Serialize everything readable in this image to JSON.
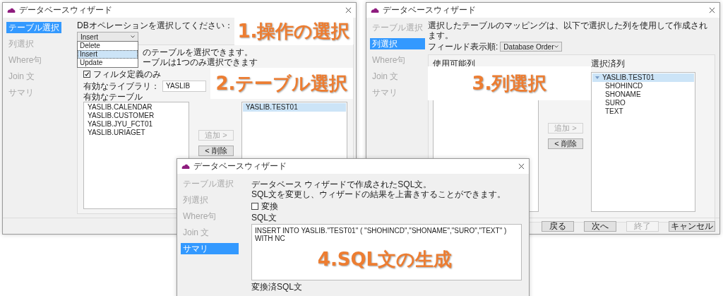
{
  "window_1": {
    "title": "データベースウィザード",
    "steps": [
      {
        "label": "テーブル選択",
        "selected": true
      },
      {
        "label": "列選択",
        "selected": false
      },
      {
        "label": "Where句",
        "selected": false
      },
      {
        "label": "Join 文",
        "selected": false
      },
      {
        "label": "サマリ",
        "selected": false
      }
    ],
    "operation_label": "DBオペレーションを選択してください：",
    "operation_value": "Insert",
    "operation_options": [
      {
        "label": "Delete",
        "selected": false
      },
      {
        "label": "Insert",
        "selected": true
      },
      {
        "label": "Update",
        "selected": false
      }
    ],
    "instructions": [
      "のテーブルを選択できます。",
      "ーブルは1つのみ選択できます"
    ],
    "filter_checkbox": {
      "label": "フィルタ定義のみ",
      "checked": true
    },
    "library_label": "有効なライブラリ：",
    "library_value": "YASLIB",
    "tables_label": "有効なテーブル",
    "available_tables": [
      "YASLIB.CALENDAR",
      "YASLIB.CUSTOMER",
      "YASLIB.JYU_FCT01",
      "YASLIB.URIAGET"
    ],
    "add_button": {
      "label": "追加 >",
      "disabled": true
    },
    "remove_button": {
      "label": "< 削除",
      "disabled": false
    },
    "selected_tables": [
      {
        "label": "YASLIB.TEST01",
        "selected": true
      }
    ]
  },
  "window_2": {
    "title": "データベースウィザード",
    "steps": [
      {
        "label": "テーブル選択",
        "selected": false
      },
      {
        "label": "列選択",
        "selected": true
      },
      {
        "label": "Where句",
        "selected": false
      },
      {
        "label": "Join 文",
        "selected": false
      },
      {
        "label": "サマリ",
        "selected": false
      }
    ],
    "description": "選択したテーブルのマッピングは、以下で選択した列を使用して作成されます。",
    "order_label": "フィールド表示順:",
    "order_value": "Database Order",
    "available_columns_label": "使用可能列",
    "selected_columns_label": "選択済列",
    "selected_tree": [
      {
        "label": "YASLIB.TEST01",
        "expanded": true,
        "selected": true,
        "children": [
          {
            "label": "SHOHINCD",
            "selected": false
          },
          {
            "label": "SHONAME",
            "selected": false
          },
          {
            "label": "SURO",
            "selected": false
          },
          {
            "label": "TEXT",
            "selected": false
          }
        ]
      }
    ],
    "add_button": {
      "label": "追加 >",
      "disabled": true
    },
    "remove_button": {
      "label": "< 削除",
      "disabled": false
    },
    "footer_buttons": [
      {
        "label": "戻る",
        "disabled": false
      },
      {
        "label": "次へ",
        "disabled": false
      },
      {
        "label": "終了",
        "disabled": true
      },
      {
        "label": "キャンセル",
        "disabled": false
      }
    ]
  },
  "window_3": {
    "title": "データベースウィザード",
    "steps": [
      {
        "label": "テーブル選択",
        "selected": false
      },
      {
        "label": "列選択",
        "selected": false
      },
      {
        "label": "Where句",
        "selected": false
      },
      {
        "label": "Join 文",
        "selected": false
      },
      {
        "label": "サマリ",
        "selected": true
      }
    ],
    "description": [
      "データベース ウィザードで作成されたSQL文。",
      "SQL文を変更し、ウィザードの結果を上書きすることができます。"
    ],
    "convert_checkbox": {
      "label": "変換",
      "checked": false
    },
    "sql_label": "SQL文",
    "sql_text": "INSERT INTO YASLIB.\"TEST01\" ( \"SHOHINCD\",\"SHONAME\",\"SURO\",\"TEXT\" ) WITH NC",
    "converted_label": "変換済SQL文"
  },
  "callouts": [
    {
      "text": "1.操作の選択"
    },
    {
      "text": "2.テーブル選択"
    },
    {
      "text": "3.列選択"
    },
    {
      "text": "4.SQL文の生成"
    }
  ]
}
